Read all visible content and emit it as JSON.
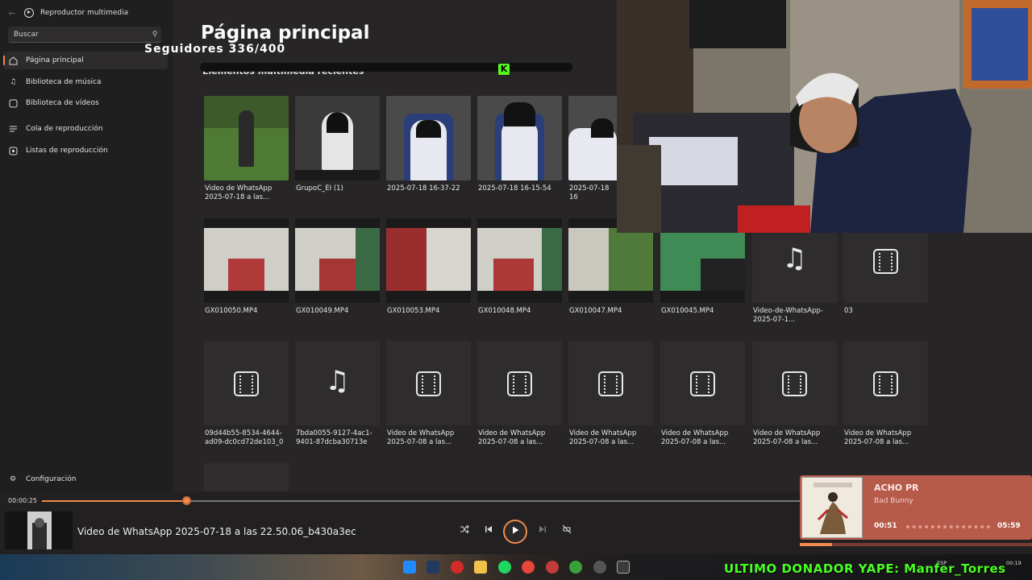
{
  "app": {
    "title": "Reproductor multimedia"
  },
  "search": {
    "placeholder": "Buscar"
  },
  "sidebar": {
    "items": [
      {
        "label": "Página principal",
        "icon": "home-icon",
        "active": true
      },
      {
        "label": "Biblioteca de música",
        "icon": "music-note-icon"
      },
      {
        "label": "Biblioteca de vídeos",
        "icon": "video-library-icon"
      },
      {
        "label": "Cola de reproducción",
        "icon": "queue-icon"
      },
      {
        "label": "Listas de reproducción",
        "icon": "playlist-icon"
      }
    ],
    "settings_label": "Configuración"
  },
  "main": {
    "title": "Página principal",
    "section_title": "Elementos multimedia recientes",
    "row1": [
      {
        "label": "Video de WhatsApp 2025-07-18 a las..."
      },
      {
        "label": "GrupoC_EI (1)"
      },
      {
        "label": "2025-07-18 16-37-22"
      },
      {
        "label": "2025-07-18 16-15-54"
      },
      {
        "label": "2025-07-18 16"
      }
    ],
    "row2": [
      {
        "label": "GX010050.MP4"
      },
      {
        "label": "GX010049.MP4"
      },
      {
        "label": "GX010053.MP4"
      },
      {
        "label": "GX010048.MP4"
      },
      {
        "label": "GX010047.MP4"
      },
      {
        "label": "GX010045.MP4"
      },
      {
        "label": "Video-de-WhatsApp-2025-07-1..."
      },
      {
        "label": "03"
      }
    ],
    "row3": [
      {
        "label": "09d44b55-8534-4644-ad09-dc0cd72de103_0"
      },
      {
        "label": "7bda0055-9127-4ac1-9401-87dcba30713e"
      },
      {
        "label": "Video de WhatsApp 2025-07-08 a las..."
      },
      {
        "label": "Video de WhatsApp 2025-07-08 a las..."
      },
      {
        "label": "Video de WhatsApp 2025-07-08 a las..."
      },
      {
        "label": "Video de WhatsApp 2025-07-08 a las..."
      },
      {
        "label": "Video de WhatsApp 2025-07-08 a las..."
      },
      {
        "label": "Video de WhatsApp 2025-07-08 a las..."
      }
    ]
  },
  "overlay": {
    "followers": "Seguidores 336/400",
    "kick_letter": "K",
    "donor": "ULTIMO DONADOR YAPE: Manfer_Torres"
  },
  "player": {
    "current_time": "00:00:25",
    "progress_fraction": 0.19,
    "now_playing": "Video de WhatsApp 2025-07-18 a las 22.50.06_b430a3ec"
  },
  "music_widget": {
    "title": "ACHO PR",
    "artist": "Bad Bunny",
    "elapsed": "00:51",
    "duration": "05:59",
    "progress_fraction": 0.14
  },
  "tray": {
    "lang": "ESP",
    "time": "00:19"
  },
  "colors": {
    "accent": "#f08a4b",
    "background": "#272526",
    "sidebar": "#201f20",
    "music_card": "#b65a4a",
    "donor_text": "#49ff22"
  }
}
